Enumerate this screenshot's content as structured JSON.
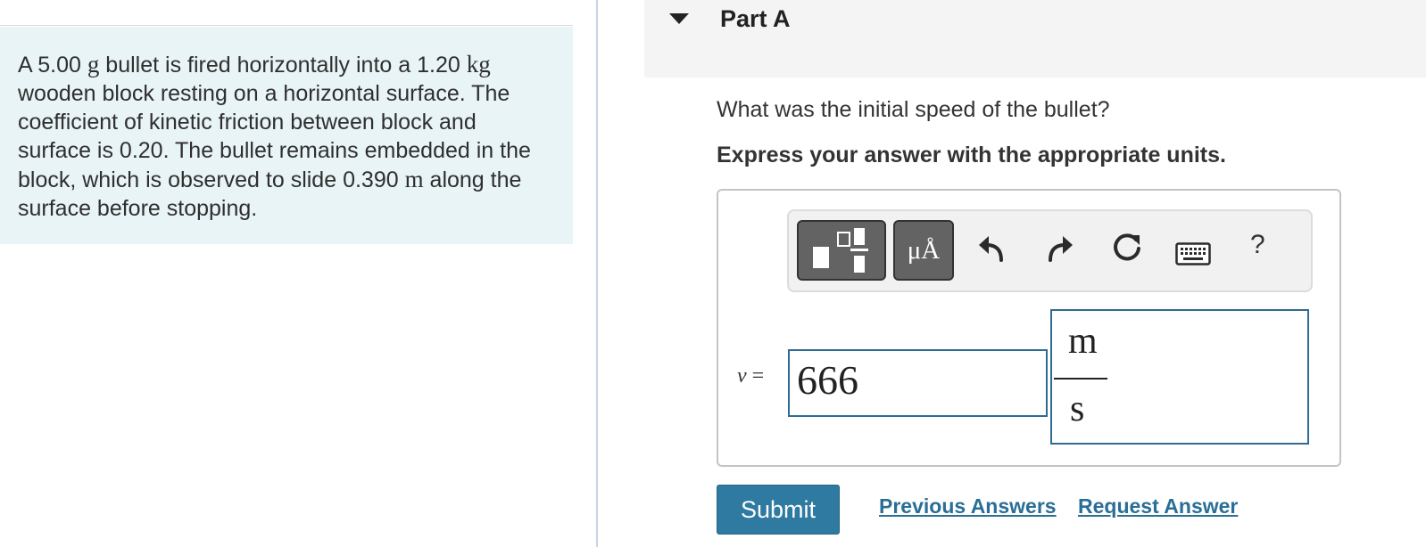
{
  "problem": {
    "segments": [
      {
        "text": "A 5.00 ",
        "unit": false
      },
      {
        "text": "g",
        "unit": true
      },
      {
        "text": " bullet is fired horizontally into a 1.20 ",
        "unit": false
      },
      {
        "text": "kg",
        "unit": true
      },
      {
        "text": " wooden block resting on a horizontal surface. The coefficient of kinetic friction between block and surface is 0.20. The bullet remains embedded in the block, which is observed to slide 0.390 ",
        "unit": false
      },
      {
        "text": "m",
        "unit": true
      },
      {
        "text": " along the surface before stopping.",
        "unit": false
      }
    ]
  },
  "part": {
    "title": "Part A"
  },
  "question": "What was the initial speed of the bullet?",
  "instruction": "Express your answer with the appropriate units.",
  "toolbar": {
    "units_label": "μÅ",
    "help_label": "?"
  },
  "answer": {
    "variable": "v",
    "equals": " =",
    "value": "666",
    "unit_numerator": "m",
    "unit_denominator": "s"
  },
  "actions": {
    "submit_label": "Submit",
    "previous_answers_label": "Previous Answers",
    "request_answer_label": "Request Answer"
  },
  "colors": {
    "problem_bg": "#e8f4f6",
    "accent": "#2e7aa0",
    "link": "#2a6e96",
    "input_border": "#2f6b93"
  }
}
